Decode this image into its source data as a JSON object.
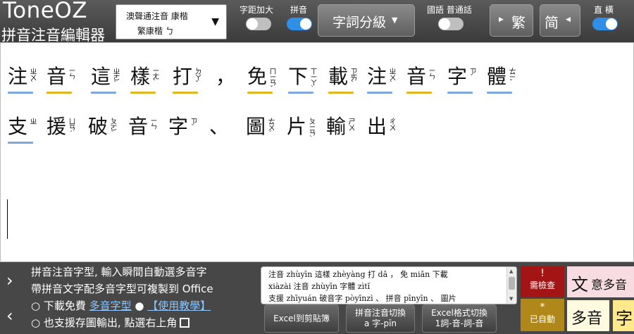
{
  "app": {
    "name": "ToneOZ",
    "subtitle": "拼音注音編輯器"
  },
  "toolbar": {
    "font_select": {
      "line1": "澳聲通注音 康楷",
      "line2": "繁康楷 ㄅ"
    },
    "spacing_label": "字距加大",
    "spacing_on": false,
    "pinyin_label": "拼音",
    "pinyin_on": true,
    "level_button": "字詞分級",
    "lang_label": "國語 普通話",
    "lang_on": false,
    "trad_button": "繁",
    "simp_button": "简",
    "orientation_label": "直 橫",
    "orientation_on": true
  },
  "editor": {
    "line1": [
      {
        "ch": "注",
        "zy": "ㄓㄨˋ",
        "ul": "#7ea6e0"
      },
      {
        "ch": "音",
        "zy": "ㄧㄣ",
        "ul": "#e0b81e"
      },
      {
        "ch": "這",
        "zy": "ㄓㄜˋ",
        "ul": "#7ea6e0"
      },
      {
        "ch": "樣",
        "zy": "ㄧㄤˋ",
        "ul": "#e0b81e"
      },
      {
        "ch": "打",
        "zy": "ㄉㄚˇ",
        "ul": "#e0b81e"
      },
      {
        "ch": "，",
        "zy": "",
        "ul": ""
      },
      {
        "ch": "免",
        "zy": "ㄇㄧㄢˇ",
        "ul": "#e0b81e"
      },
      {
        "ch": "下",
        "zy": "ㄒㄧㄚˋ",
        "ul": "#7ea6e0"
      },
      {
        "ch": "載",
        "zy": "ㄗㄞˋ",
        "ul": "#e0b81e"
      },
      {
        "ch": "注",
        "zy": "ㄓㄨˋ",
        "ul": "#7ea6e0"
      },
      {
        "ch": "音",
        "zy": "ㄧㄣ",
        "ul": "#e0b81e"
      },
      {
        "ch": "字",
        "zy": "ㄗˋ",
        "ul": "#7ea6e0"
      },
      {
        "ch": "體",
        "zy": "ㄊㄧˇ",
        "ul": "#7ea6e0"
      }
    ],
    "line2": [
      {
        "ch": "支",
        "zy": "ㄓ",
        "ul": "#7ea6e0"
      },
      {
        "ch": "援",
        "zy": "ㄩㄢˊ",
        "ul": ""
      },
      {
        "ch": "破",
        "zy": "ㄆㄛˋ",
        "ul": ""
      },
      {
        "ch": "音",
        "zy": "ㄧㄣ",
        "ul": ""
      },
      {
        "ch": "字",
        "zy": "ㄗˋ",
        "ul": ""
      },
      {
        "ch": "、",
        "zy": "",
        "ul": ""
      },
      {
        "ch": "圖",
        "zy": "ㄊㄨˊ",
        "ul": ""
      },
      {
        "ch": "片",
        "zy": "ㄆㄧㄢˋ",
        "ul": ""
      },
      {
        "ch": "輸",
        "zy": "ㄕㄨ",
        "ul": ""
      },
      {
        "ch": "出",
        "zy": "ㄔㄨ",
        "ul": ""
      }
    ]
  },
  "bottom": {
    "nav_next": "›",
    "nav_prev": "‹",
    "info_line1": "拼音注音字型, 輸入瞬間自動選多音字",
    "info_line2": "帶拼音文字配多音字型可複製到 Office",
    "info_line3_prefix": "○ 下載免費 ",
    "info_link1": "多音字型",
    "info_line3_mid": " ● ",
    "info_link2": "【使用教學】",
    "info_line4": "○ 也支援存圖輸出, 點選右上角",
    "preview": [
      "注音 zhùyīn 這樣 zhèyàng 打 dǎ ， 免 miǎn 下載",
      "xiàzài 注音 zhùyīn 字體 zìtǐ",
      "支援 zhīyuán 破音字 pòyīnzì 、 拼音 pīnyīn 、 圖片"
    ],
    "btn_copy": "Excel到剪貼簿",
    "btn_switch_1": "拼音注音切換",
    "btn_switch_2": "a 字-pīn",
    "btn_excel_1": "Excel格式切換",
    "btn_excel_2": "1詞-音-詞-音",
    "check_mark": "!",
    "check_label": "需檢查",
    "auto_mark": "*",
    "auto_label": "已自動",
    "poly_big": "文",
    "poly_rest": "意多音",
    "poly_bot": "多音",
    "poly_bot2": "字"
  },
  "colors": {
    "underline_blue": "#7ea6e0",
    "underline_yellow": "#e0b81e",
    "check_red": "#a31515",
    "auto_gold": "#b0881a",
    "toggle_blue": "#2f8ee5"
  }
}
